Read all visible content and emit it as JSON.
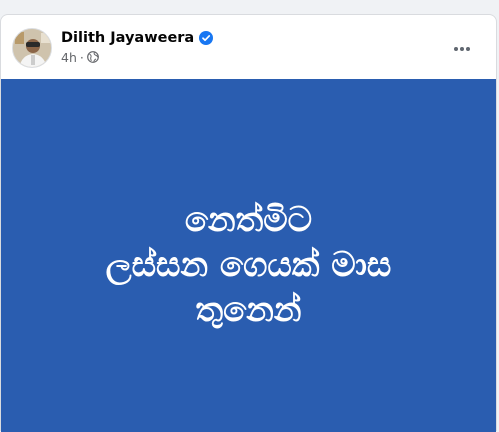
{
  "post": {
    "author": "Dilith Jayaweera",
    "time": "4h",
    "separator": "·",
    "verified_icon": "verified-badge-icon",
    "audience_icon": "globe-icon",
    "menu_icon": "more-horizontal-icon",
    "background_color": "#2a5db0",
    "text_lines": [
      "නෙත්මිට",
      "ලස්සන ගෙයක් මාස",
      "තුනෙන්"
    ]
  }
}
